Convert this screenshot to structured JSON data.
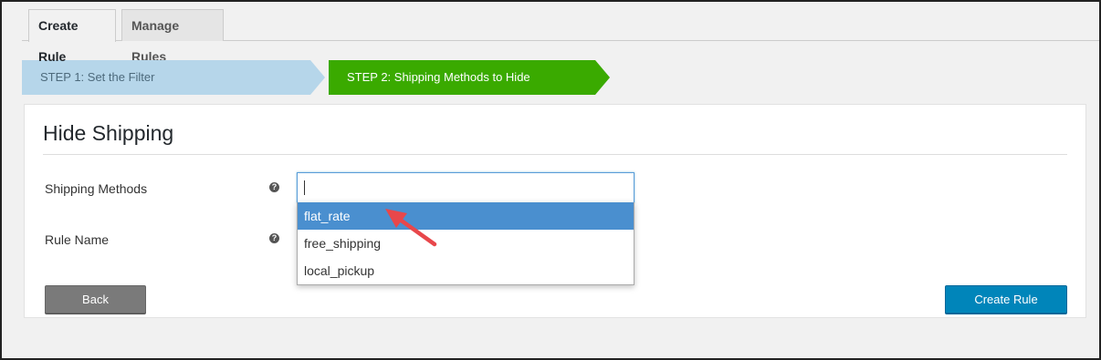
{
  "tabs": [
    {
      "label": "Create Rule",
      "active": true
    },
    {
      "label": "Manage Rules",
      "active": false
    }
  ],
  "steps": [
    {
      "label": "STEP 1: Set the Filter",
      "color": "#b6d6ea"
    },
    {
      "label": "STEP 2: Shipping Methods to Hide",
      "color": "#3aaa00"
    }
  ],
  "panel": {
    "title": "Hide Shipping",
    "fields": {
      "shipping_methods_label": "Shipping Methods",
      "shipping_methods_value": "",
      "rule_name_label": "Rule Name",
      "help_icon": "?"
    },
    "dropdown_options": [
      "flat_rate",
      "free_shipping",
      "local_pickup"
    ],
    "highlighted_option": "flat_rate",
    "back_label": "Back",
    "create_label": "Create Rule"
  },
  "colors": {
    "accent_blue": "#0085ba",
    "highlight": "#4a8fcf",
    "arrow": "#e8474b"
  }
}
